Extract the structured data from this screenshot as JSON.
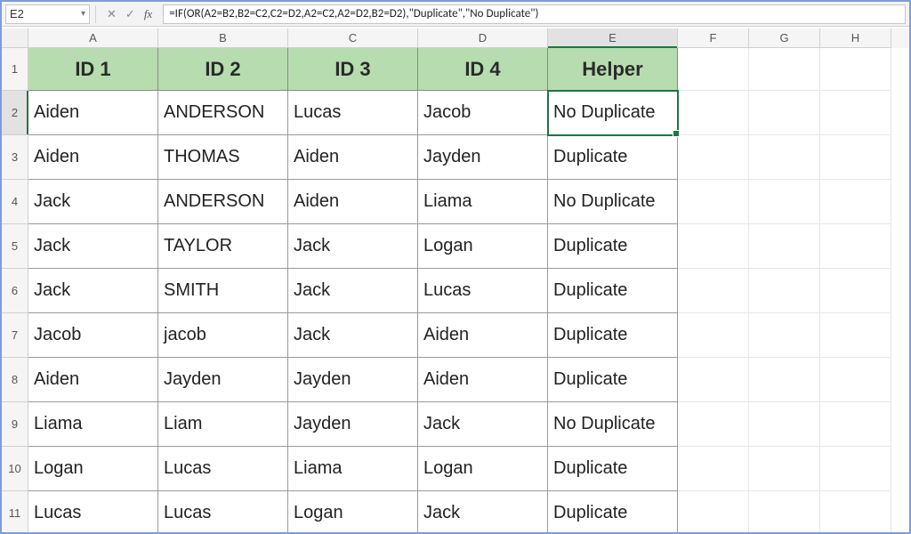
{
  "namebox": {
    "ref": "E2"
  },
  "formula": "=IF(OR(A2=B2,B2=C2,C2=D2,A2=C2,A2=D2,B2=D2),\"Duplicate\",\"No Duplicate\")",
  "columns": [
    "A",
    "B",
    "C",
    "D",
    "E",
    "F",
    "G",
    "H"
  ],
  "selectedCol": "E",
  "selectedRow": 2,
  "headers": [
    "ID 1",
    "ID 2",
    "ID 3",
    "ID 4",
    "Helper"
  ],
  "rows": [
    {
      "n": 2,
      "c": [
        "Aiden",
        "ANDERSON",
        "Lucas",
        "Jacob",
        "No Duplicate"
      ]
    },
    {
      "n": 3,
      "c": [
        "Aiden",
        "THOMAS",
        "Aiden",
        "Jayden",
        "Duplicate"
      ]
    },
    {
      "n": 4,
      "c": [
        "Jack",
        "ANDERSON",
        "Aiden",
        "Liama",
        "No Duplicate"
      ]
    },
    {
      "n": 5,
      "c": [
        "Jack",
        "TAYLOR",
        "Jack",
        "Logan",
        "Duplicate"
      ]
    },
    {
      "n": 6,
      "c": [
        "Jack",
        "SMITH",
        "Jack",
        "Lucas",
        "Duplicate"
      ]
    },
    {
      "n": 7,
      "c": [
        "Jacob",
        "jacob",
        "Jack",
        "Aiden",
        "Duplicate"
      ]
    },
    {
      "n": 8,
      "c": [
        "Aiden",
        "Jayden",
        "Jayden",
        "Aiden",
        "Duplicate"
      ]
    },
    {
      "n": 9,
      "c": [
        "Liama",
        "Liam",
        "Jayden",
        "Jack",
        "No Duplicate"
      ]
    },
    {
      "n": 10,
      "c": [
        "Logan",
        "Lucas",
        "Liama",
        "Logan",
        "Duplicate"
      ]
    },
    {
      "n": 11,
      "c": [
        "Lucas",
        "Lucas",
        "Logan",
        "Jack",
        "Duplicate"
      ]
    }
  ],
  "icons": {
    "cancel": "✕",
    "enter": "✓",
    "fx": "fx",
    "chev": "▾"
  }
}
